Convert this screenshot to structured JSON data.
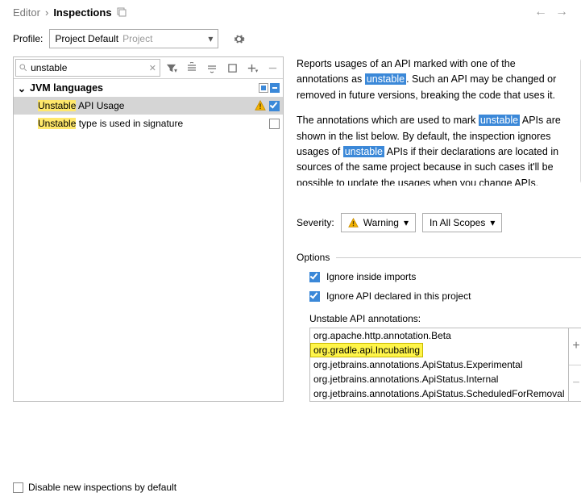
{
  "breadcrumb": {
    "parent": "Editor",
    "current": "Inspections"
  },
  "profile": {
    "label": "Profile:",
    "main": "Project Default",
    "sub": "Project"
  },
  "search": {
    "value": "unstable"
  },
  "tree": {
    "group": "JVM languages",
    "items": [
      {
        "hl": "Unstable",
        "rest": " API Usage",
        "warn": true,
        "checked": true,
        "selected": true
      },
      {
        "hl": "Unstable",
        "rest": " type is used in signature",
        "warn": false,
        "checked": false,
        "selected": false
      }
    ]
  },
  "description": {
    "p1a": "Reports usages of an API marked with one of the annotations as ",
    "p1tag": "unstable",
    "p1b": ". Such an API may be changed or removed in future versions, breaking the code that uses it.",
    "p2a": "The annotations which are used to mark ",
    "p2tag": "unstable",
    "p2b": " APIs are shown in the list below. By default, the inspection ignores usages of ",
    "p2tag2": "unstable",
    "p2c": " APIs if their declarations are located in sources of the same project because in such cases it'll be possible to update the usages when you change APIs."
  },
  "severity": {
    "label": "Severity:",
    "value": "Warning",
    "scope": "In All Scopes"
  },
  "options": {
    "title": "Options",
    "opt1": "Ignore inside imports",
    "opt2": "Ignore API declared in this project",
    "anno_label": "Unstable API annotations:",
    "annotations": [
      "org.apache.http.annotation.Beta",
      "org.gradle.api.Incubating",
      "org.jetbrains.annotations.ApiStatus.Experimental",
      "org.jetbrains.annotations.ApiStatus.Internal",
      "org.jetbrains.annotations.ApiStatus.ScheduledForRemoval"
    ]
  },
  "footer": {
    "disable_new": "Disable new inspections by default"
  }
}
